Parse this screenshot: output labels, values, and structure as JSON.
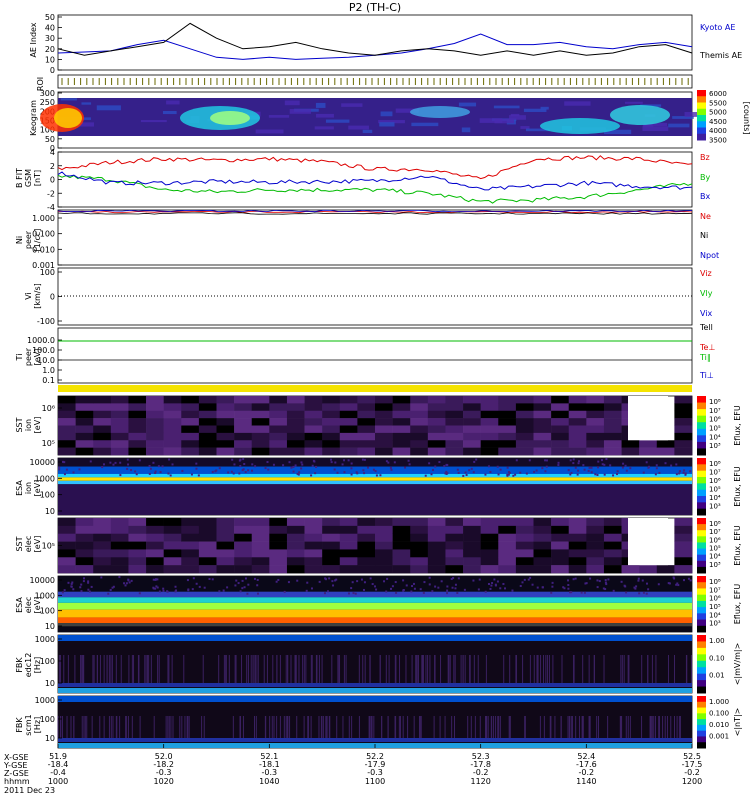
{
  "title": "P2 (TH-C)",
  "panels": {
    "ae": {
      "ylabel": "AE Index",
      "yticks": [
        "0",
        "10",
        "20",
        "30",
        "40",
        "50"
      ],
      "legend": [
        "Kyoto AE",
        "Themis AE"
      ],
      "legend_colors": [
        "#0000cc",
        "#000000"
      ]
    },
    "roi": {
      "ylabel": "ROI"
    },
    "keogram": {
      "ylabel": "Keogram",
      "yticks": [
        "0",
        "50",
        "100",
        "150",
        "200",
        "250",
        "300"
      ],
      "colorbar_ticks": [
        "6000",
        "5500",
        "5000",
        "4500",
        "4000",
        "3500"
      ],
      "colorbar_label": "[counts]"
    },
    "bfield": {
      "ylabel": "B FIT",
      "ysub": "[nT]",
      "ysub2": "GSM",
      "yticks": [
        "-4",
        "-2",
        "0",
        "2",
        "4"
      ],
      "legend": [
        "Bz",
        "By",
        "Bx"
      ],
      "legend_colors": [
        "#dd0000",
        "#00bb00",
        "#0000cc"
      ]
    },
    "density": {
      "ylabel": "Ni",
      "ysub": "[1/cc]",
      "ysub2": "peer",
      "yticks": [
        "0.001",
        "0.010",
        "0.100",
        "1.000"
      ],
      "legend": [
        "Ne",
        "Ni",
        "Npot"
      ],
      "legend_colors": [
        "#dd0000",
        "#000000",
        "#0000cc"
      ]
    },
    "velocity": {
      "ylabel": "Vi",
      "ysub": "[km/s]",
      "yticks": [
        "-100",
        "0",
        "100"
      ],
      "legend": [
        "Viz",
        "Vly",
        "Vix"
      ],
      "legend_colors": [
        "#dd0000",
        "#00bb00",
        "#0000cc"
      ]
    },
    "temperature": {
      "ylabel": "Ti",
      "ysub": "[eV]",
      "ysub2": "peer",
      "yticks": [
        "0.1",
        "1.0",
        "10.0",
        "100.0",
        "1000.0"
      ],
      "legend": [
        "Tell",
        "Te⊥",
        "Ti∥",
        "Ti⊥"
      ],
      "legend_colors": [
        "#000000",
        "#dd0000",
        "#00bb00",
        "#0000cc"
      ]
    },
    "sst_i": {
      "ylabel": "SST",
      "ysub": "[eV]",
      "ysub2": "ion",
      "yticks": [
        "10⁵",
        "10⁶"
      ]
    },
    "esa_i": {
      "ylabel": "ESA",
      "ysub": "[eV]",
      "ysub2": "ion",
      "yticks": [
        "10",
        "100",
        "1000",
        "10000"
      ]
    },
    "sst_e": {
      "ylabel": "SST",
      "ysub": "[eV]",
      "ysub2": "elec",
      "yticks": [
        "10⁵"
      ]
    },
    "esa_e": {
      "ylabel": "ESA",
      "ysub": "[eV]",
      "ysub2": "elec",
      "yticks": [
        "10",
        "100",
        "1000",
        "10000"
      ]
    },
    "fbk_edc": {
      "ylabel": "FBK",
      "ysub": "[Hz]",
      "ysub2": "edc12",
      "yticks": [
        "10",
        "100",
        "1000"
      ]
    },
    "fbk_scm": {
      "ylabel": "FBK",
      "ysub": "[Hz]",
      "ysub2": "scm1",
      "yticks": [
        "10",
        "100",
        "1000"
      ]
    }
  },
  "colorbars": {
    "eflux_ticks": [
      "10⁸",
      "10⁷",
      "10⁶",
      "10⁵",
      "10⁴",
      "10³"
    ],
    "eflux_label": "Eflux, EFU",
    "edc_ticks": [
      "1.00",
      "0.10",
      "0.01"
    ],
    "edc_label": "<|mV/m|>",
    "scm_ticks": [
      "1.000",
      "0.100",
      "0.010",
      "0.001"
    ],
    "scm_label": "<|nT|>"
  },
  "x_axis": {
    "row_labels": [
      "X-GSE",
      "Y-GSE",
      "Z-GSE",
      "hhmm",
      "2011 Dec 23"
    ],
    "columns": [
      {
        "x": "-18.4",
        "y": "-0.4",
        "z": "1000",
        "top": "51.9"
      },
      {
        "x": "-18.2",
        "y": "-0.3",
        "z": "1020",
        "top": "52.0"
      },
      {
        "x": "-18.1",
        "y": "-0.3",
        "z": "1040",
        "top": "52.1"
      },
      {
        "x": "-17.9",
        "y": "-0.3",
        "z": "1100",
        "top": "52.2"
      },
      {
        "x": "-17.8",
        "y": "-0.2",
        "z": "1120",
        "top": "52.3"
      },
      {
        "x": "-17.6",
        "y": "-0.2",
        "z": "1140",
        "top": "52.4"
      },
      {
        "x": "-17.5",
        "y": "-0.2",
        "z": "1200",
        "top": "52.5"
      }
    ]
  },
  "chart_data": [
    {
      "type": "line",
      "title": "P2 (TH-C)",
      "ylabel": "AE Index",
      "ylim": [
        0,
        50
      ],
      "x": [
        "1000",
        "1005",
        "1010",
        "1015",
        "1020",
        "1025",
        "1030",
        "1035",
        "1040",
        "1045",
        "1050",
        "1055",
        "1100",
        "1105",
        "1110",
        "1115",
        "1120",
        "1125",
        "1130",
        "1135",
        "1140",
        "1145",
        "1150",
        "1155",
        "1200"
      ],
      "series": [
        {
          "name": "Kyoto AE",
          "values": [
            16,
            17,
            18,
            24,
            28,
            20,
            12,
            10,
            12,
            10,
            11,
            12,
            14,
            16,
            20,
            25,
            34,
            24,
            24,
            26,
            22,
            20,
            24,
            26,
            22
          ]
        },
        {
          "name": "Themis AE",
          "values": [
            20,
            14,
            18,
            22,
            26,
            44,
            30,
            20,
            22,
            26,
            20,
            16,
            14,
            18,
            20,
            18,
            14,
            18,
            14,
            18,
            14,
            16,
            22,
            24,
            16
          ]
        }
      ]
    },
    {
      "type": "line",
      "ylabel": "B FIT",
      "ylim": [
        -4,
        4
      ],
      "x": [
        "1000",
        "1010",
        "1020",
        "1030",
        "1040",
        "1050",
        "1100",
        "1110",
        "1120",
        "1130",
        "1140",
        "1150",
        "1200"
      ],
      "series": [
        {
          "name": "Bz",
          "values": [
            1.5,
            2.5,
            3.0,
            2.8,
            3.0,
            2.6,
            1.5,
            1.5,
            0.0,
            3.0,
            3.2,
            3.0,
            2.0
          ]
        },
        {
          "name": "By",
          "values": [
            0.5,
            0.0,
            -1.5,
            -1.8,
            -1.5,
            -1.5,
            -1.5,
            -2.0,
            -3.2,
            -3.0,
            -2.5,
            -1.5,
            -0.5
          ]
        },
        {
          "name": "Bx",
          "values": [
            1.0,
            -0.5,
            -0.5,
            -0.3,
            -0.4,
            -0.3,
            -0.2,
            0.5,
            -1.5,
            -1.0,
            -0.5,
            -1.0,
            -1.2
          ]
        }
      ]
    }
  ]
}
